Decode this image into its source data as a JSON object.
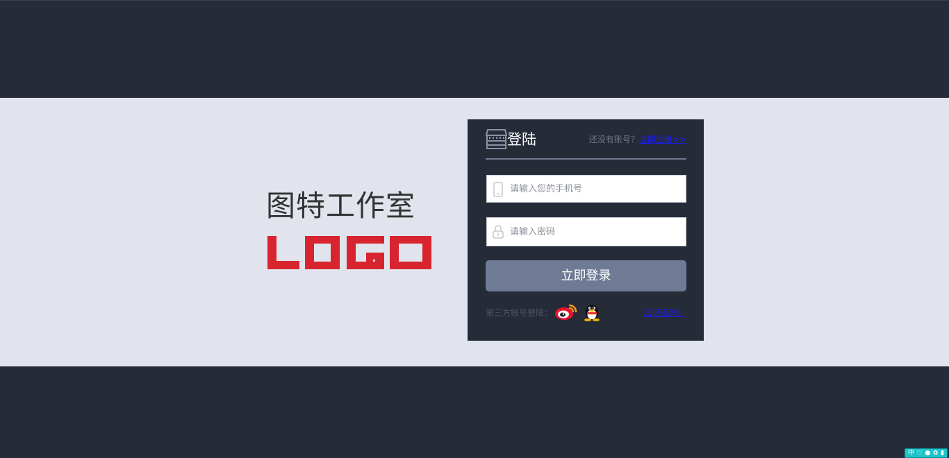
{
  "brand": {
    "name": "图特工作室",
    "logo_text": "LOGO",
    "logo_color": "#d8242f"
  },
  "login": {
    "title": "登陆",
    "no_account_text": "还没有账号？",
    "register_link": "立即注册>>",
    "phone_placeholder": "请输入您的手机号",
    "password_placeholder": "请输入密码",
    "submit_label": "立即登录",
    "third_party_label": "第三方账号登陆：",
    "forgot_password": "忘记密码？"
  },
  "ime_toolbar": {
    "items": [
      "中",
      "♡",
      "●",
      "✿",
      "▮"
    ]
  },
  "colors": {
    "dark_bg": "#262b38",
    "light_band": "#e1e4ec",
    "button": "#6f7b94",
    "link": "#1a1aff"
  },
  "icons": [
    "store-icon",
    "phone-icon",
    "lock-icon",
    "weibo-icon",
    "qq-icon"
  ]
}
